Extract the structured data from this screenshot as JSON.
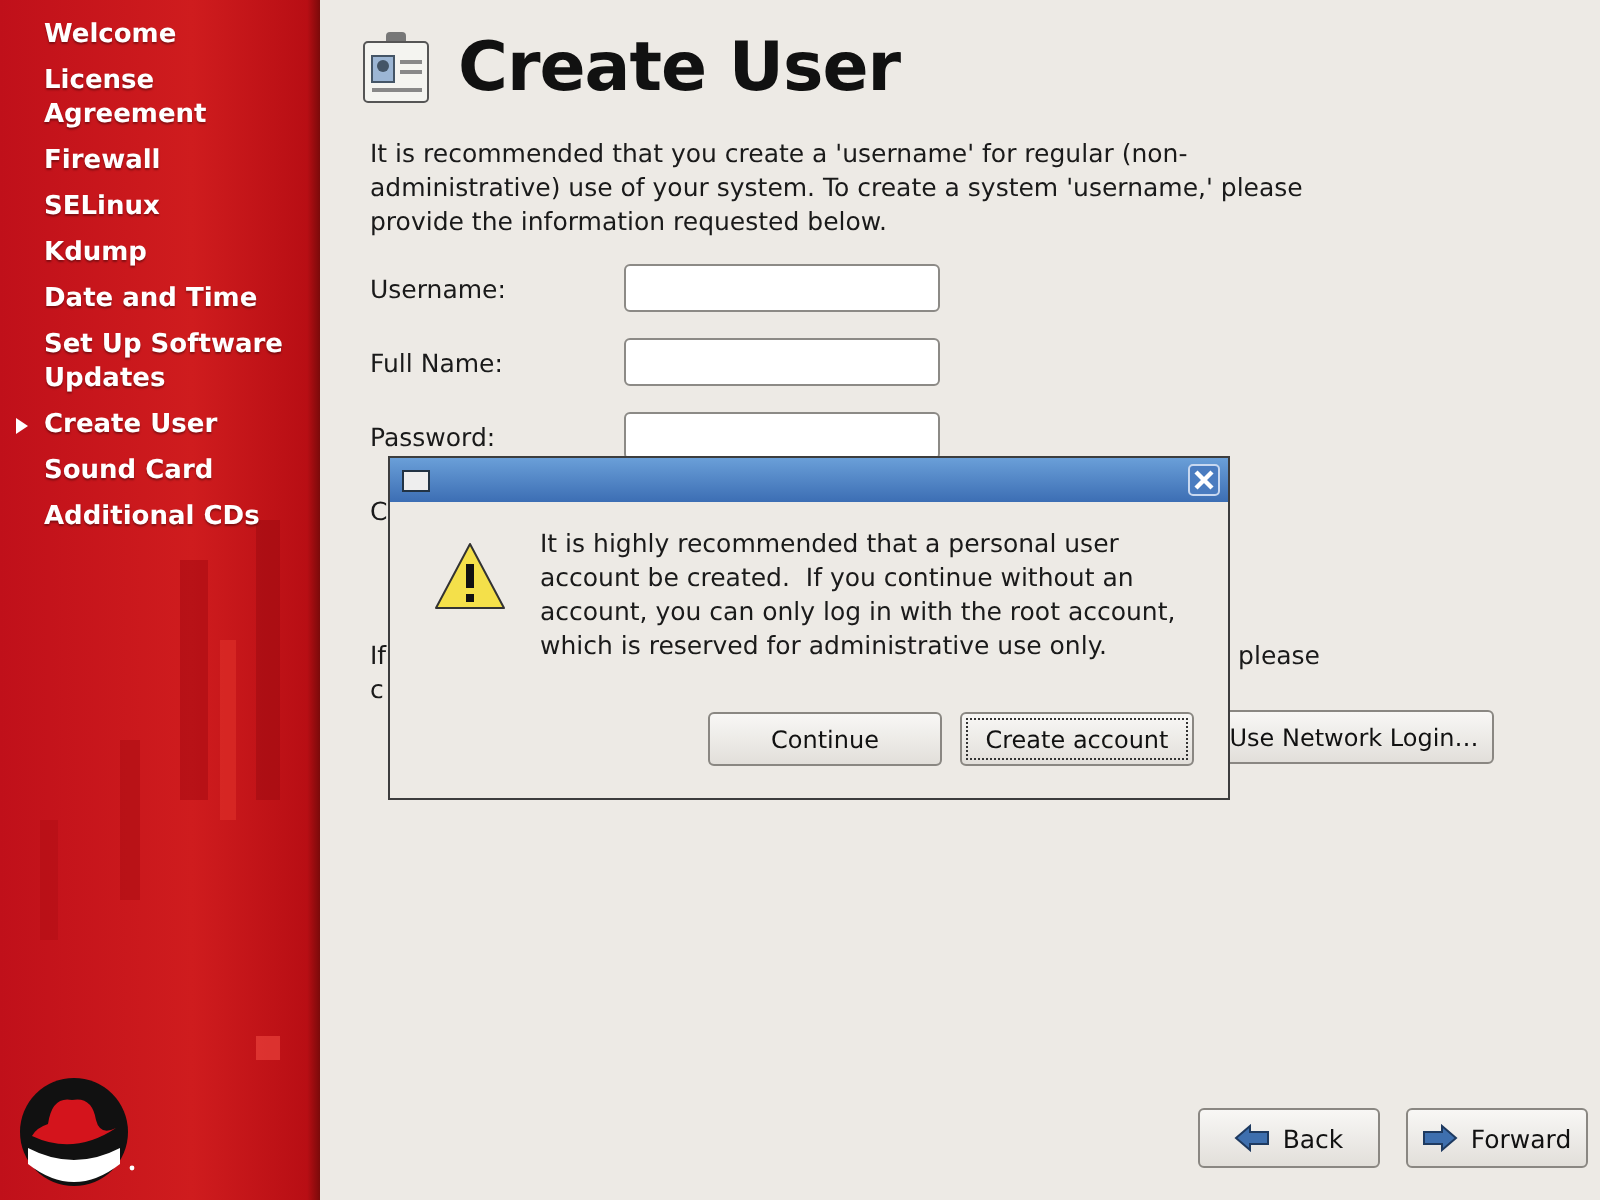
{
  "sidebar": {
    "items": [
      {
        "label": "Welcome",
        "selected": false
      },
      {
        "label": "License Agreement",
        "selected": false
      },
      {
        "label": "Firewall",
        "selected": false
      },
      {
        "label": "SELinux",
        "selected": false
      },
      {
        "label": "Kdump",
        "selected": false
      },
      {
        "label": "Date and Time",
        "selected": false
      },
      {
        "label": "Set Up Software Updates",
        "selected": false
      },
      {
        "label": "Create User",
        "selected": true
      },
      {
        "label": "Sound Card",
        "selected": false
      },
      {
        "label": "Additional CDs",
        "selected": false
      }
    ]
  },
  "page": {
    "title": "Create User",
    "intro": "It is recommended that you create a 'username' for regular (non-administrative) use of your system. To create a system 'username,' please provide the information requested below."
  },
  "form": {
    "fields": [
      {
        "label": "Username:",
        "kind": "input"
      },
      {
        "label": "Full Name:",
        "kind": "input"
      },
      {
        "label": "Password:",
        "kind": "input"
      },
      {
        "label": "C",
        "kind": "label"
      }
    ]
  },
  "network": {
    "line_1_start": "If",
    "line_1_end": "please",
    "line_2": "c",
    "button": "Use Network Login…"
  },
  "nav": {
    "back": "Back",
    "forward": "Forward"
  },
  "dialog": {
    "message": "It is highly recommended that a personal user account be created.  If you continue without an account, you can only log in with the root account, which is reserved for administrative use only.",
    "buttons": [
      {
        "label": "Continue",
        "focused": false
      },
      {
        "label": "Create account",
        "focused": true
      }
    ]
  }
}
